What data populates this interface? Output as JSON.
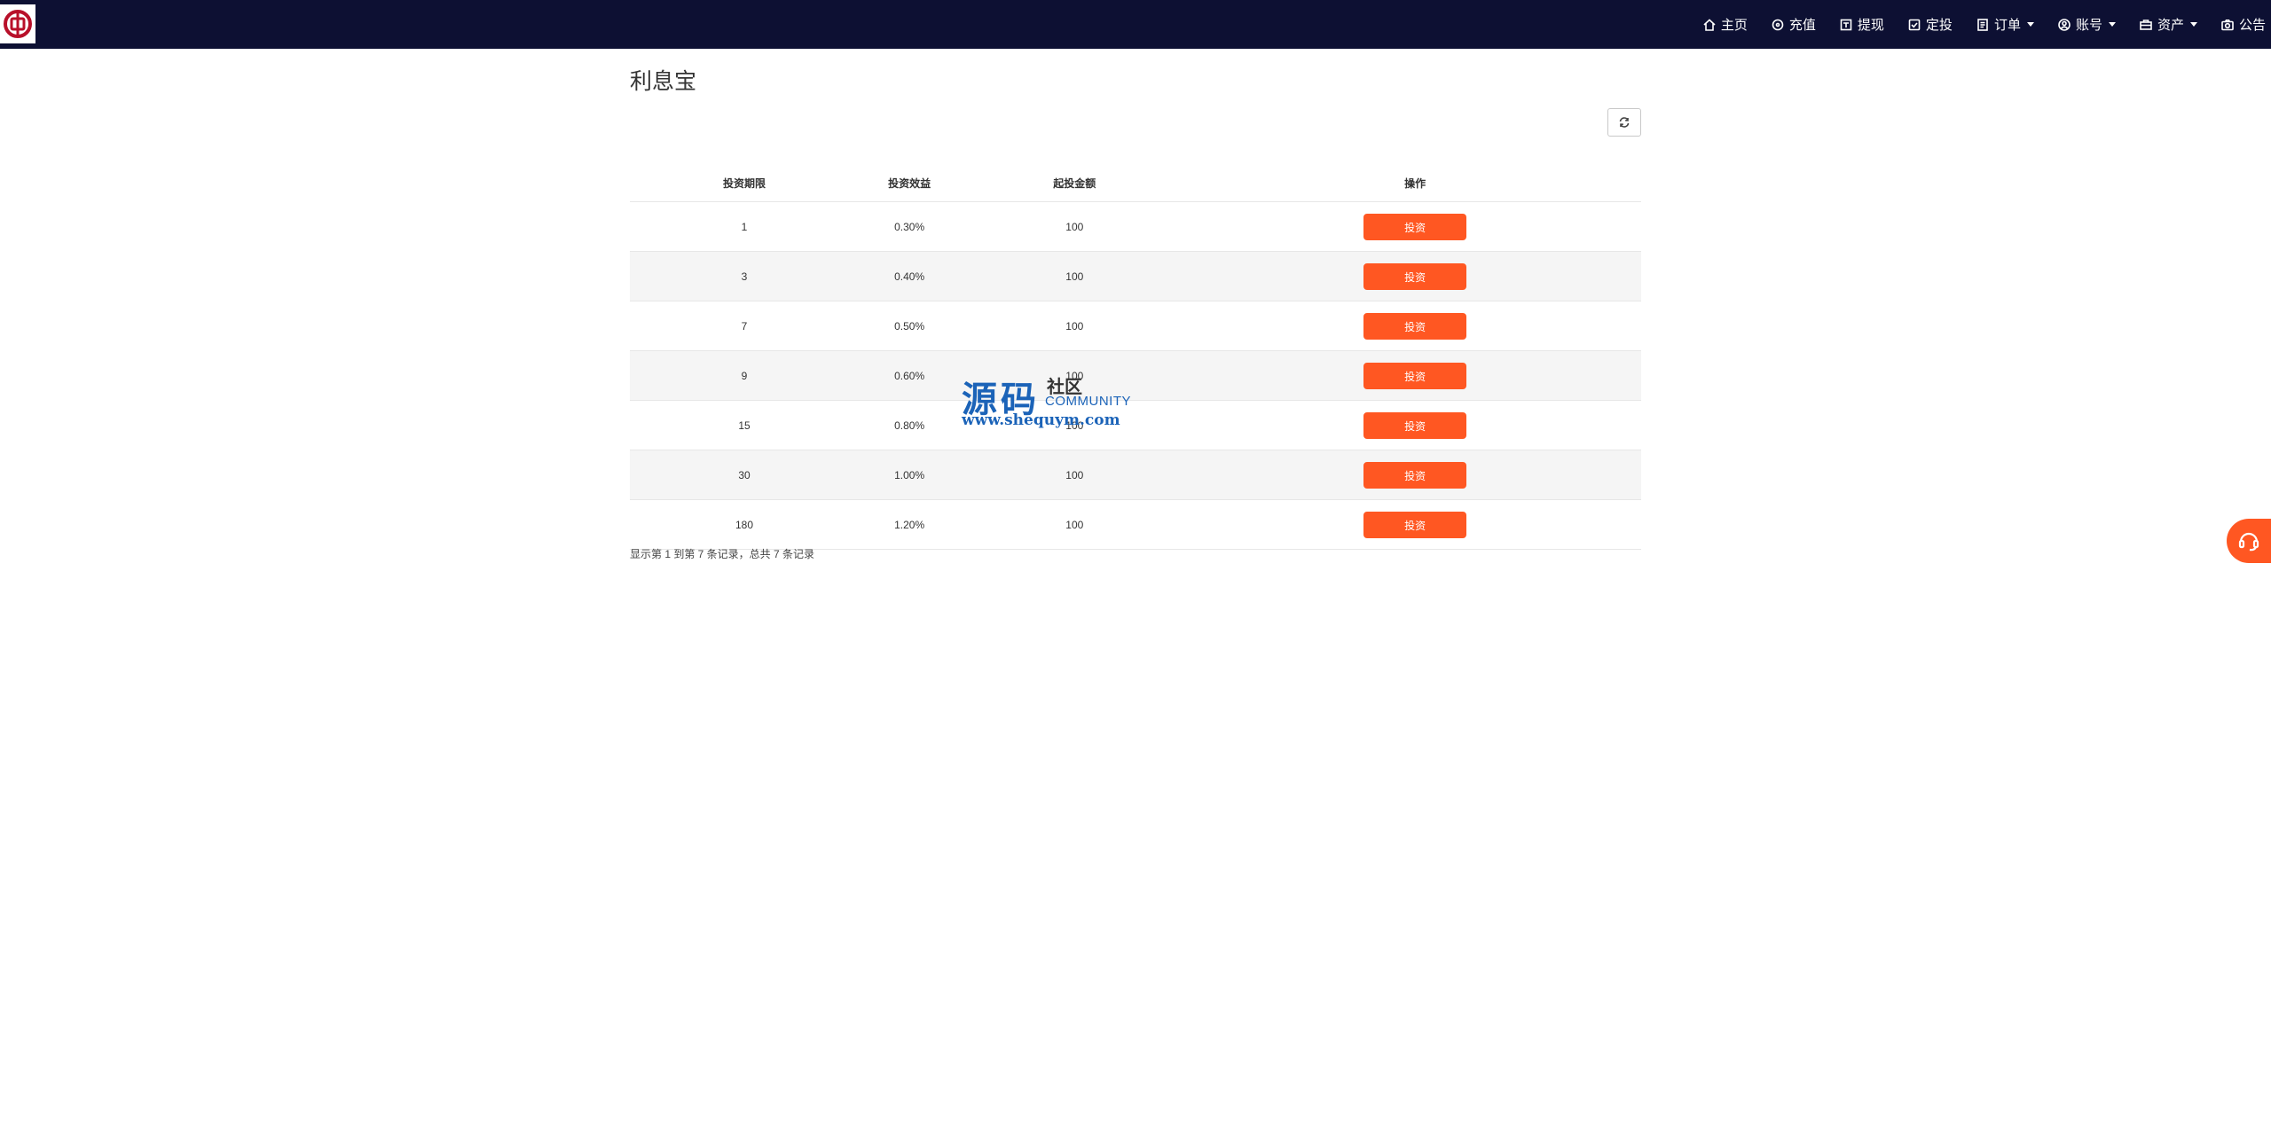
{
  "nav": {
    "items": [
      {
        "label": "主页",
        "icon": "home-icon"
      },
      {
        "label": "充值",
        "icon": "plus-circle-icon"
      },
      {
        "label": "提现",
        "icon": "withdraw-icon"
      },
      {
        "label": "定投",
        "icon": "check-square-icon"
      },
      {
        "label": "订单",
        "icon": "document-icon",
        "dropdown": true
      },
      {
        "label": "账号",
        "icon": "user-circle-icon",
        "dropdown": true
      },
      {
        "label": "资产",
        "icon": "briefcase-icon",
        "dropdown": true
      },
      {
        "label": "公告",
        "icon": "camera-icon"
      }
    ]
  },
  "page": {
    "title": "利息宝"
  },
  "table": {
    "headers": [
      "投资期限",
      "投资效益",
      "起投金额",
      "操作"
    ],
    "button_label": "投资",
    "rows": [
      {
        "term": "1",
        "rate": "0.30%",
        "min": "100"
      },
      {
        "term": "3",
        "rate": "0.40%",
        "min": "100"
      },
      {
        "term": "7",
        "rate": "0.50%",
        "min": "100"
      },
      {
        "term": "9",
        "rate": "0.60%",
        "min": "100"
      },
      {
        "term": "15",
        "rate": "0.80%",
        "min": "100"
      },
      {
        "term": "30",
        "rate": "1.00%",
        "min": "100"
      },
      {
        "term": "180",
        "rate": "1.20%",
        "min": "100"
      }
    ]
  },
  "pagination": {
    "info": "显示第 1 到第 7 条记录，总共 7 条记录"
  },
  "watermark": {
    "big": "源码",
    "small": "社区",
    "community": "COMMUNITY",
    "url": "www.shequym.com"
  },
  "colors": {
    "navbar": "#0d1033",
    "accent": "#ff5722",
    "watermark": "#1b63b8"
  }
}
